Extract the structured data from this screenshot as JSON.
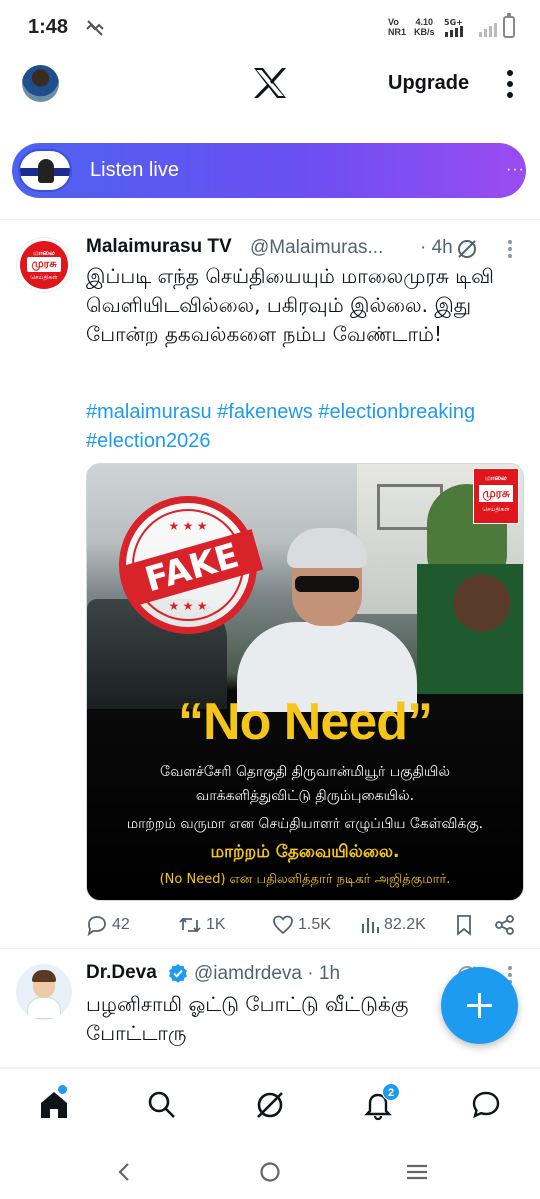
{
  "status_bar": {
    "time": "1:48",
    "network_label": "Vo\nNR1",
    "speed_value": "4.10",
    "speed_unit": "KB/s",
    "signal_label": "5G+"
  },
  "header": {
    "logo": "X",
    "upgrade_label": "Upgrade"
  },
  "listen_live": {
    "label": "Listen live",
    "more": "···"
  },
  "tweet1": {
    "name": "Malaimurasu TV",
    "handle": "@Malaimuras...",
    "time": "· 4h",
    "avatar_text": [
      "மாலை",
      "முரசு",
      "செய்திகள்"
    ],
    "body": "இப்படி எந்த செய்தியையும் மாலைமுரசு டிவி வெளியிடவில்லை, பகிரவும் இல்லை. இது போன்ற தகவல்களை நம்ப வேண்டாம்!",
    "hashtags": "#malaimurasu #fakenews #electionbreaking #election2026",
    "media": {
      "stamp_text": "FAKE",
      "stamp_stars": "★ ★ ★",
      "quote": "“No Need”",
      "line1": "வேளச்சேரி தொகுதி திருவான்மியூர் பகுதியில்",
      "line2": "வாக்களித்துவிட்டு திரும்புகையில்.",
      "line3": "மாற்றம் வருமா என செய்தியாளர் எழுப்பிய கேள்விக்கு.",
      "headline": "மாற்றம் தேவையில்லை.",
      "small": "(No Need) என பதிலளித்தார் நடிகர் அஜித்குமார்.",
      "corner_logo": [
        "மாலை",
        "முரசு",
        "செய்திகள்"
      ]
    },
    "actions": {
      "replies": "42",
      "reposts": "1K",
      "likes": "1.5K",
      "views": "82.2K"
    }
  },
  "tweet2": {
    "name": "Dr.Deva",
    "handle": "@iamdrdeva · 1h",
    "body": "பழனிசாமி ஓட்டு போட்டு வீட்டுக்கு போட்டாரு"
  },
  "bottom_nav": {
    "notifications_count": "2"
  },
  "colors": {
    "accent": "#1d9bf0",
    "listen_gradient_start": "#4d63f0",
    "listen_gradient_end": "#9a4cf0",
    "stamp_red": "#d9232a",
    "headline_gold": "#f5c518"
  }
}
